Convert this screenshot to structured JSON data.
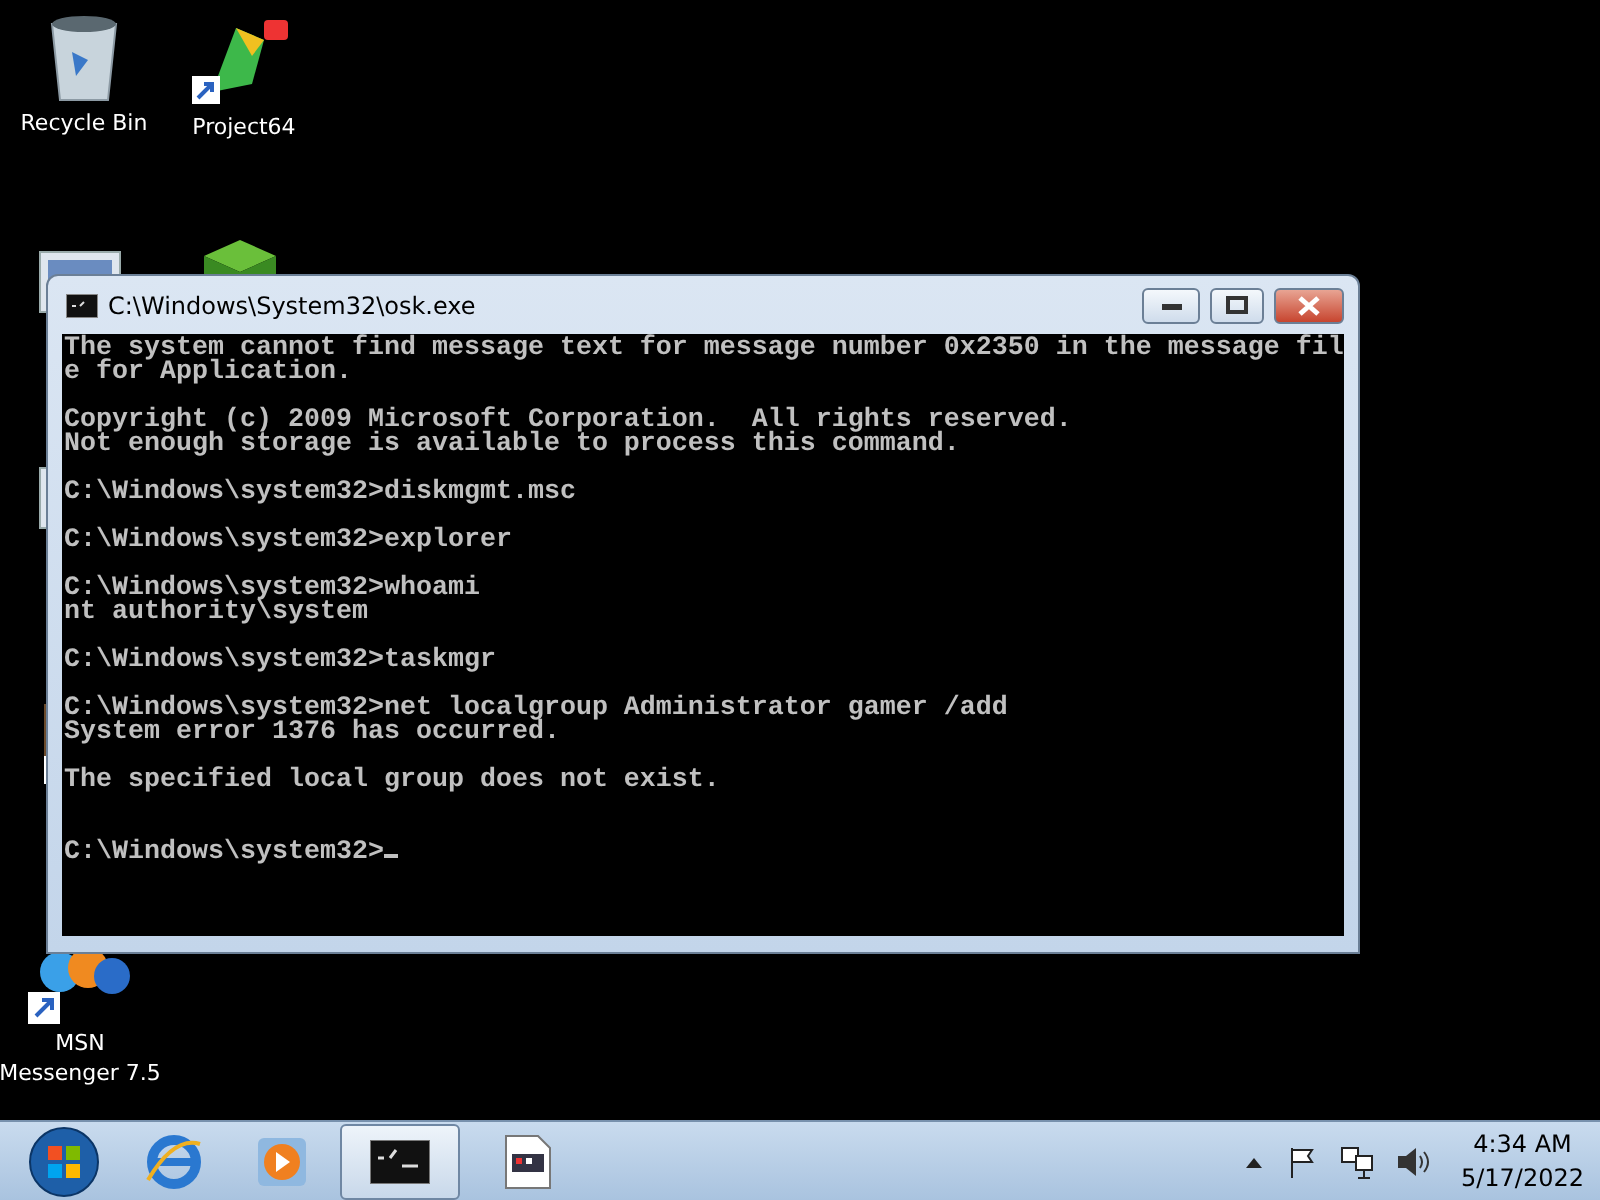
{
  "desktop": {
    "icons": [
      {
        "kind": "recycle-bin",
        "label_lines": [
          "Recycle Bin"
        ]
      },
      {
        "kind": "game-shortcut",
        "label_lines": [
          "Project64"
        ]
      },
      {
        "kind": "monitor"
      },
      {
        "kind": "cube"
      },
      {
        "kind": "monitor-small"
      },
      {
        "kind": "app-shortcut"
      },
      {
        "kind": "messenger",
        "label_lines": [
          "MSN",
          "Messenger 7.5"
        ]
      }
    ]
  },
  "window": {
    "title": "C:\\Windows\\System32\\osk.exe",
    "console": [
      {
        "kind": "text",
        "text": "The system cannot find message text for message number 0x2350 in the message fil"
      },
      {
        "kind": "text",
        "text": "e for Application."
      },
      {
        "kind": "blank"
      },
      {
        "kind": "text",
        "text": "Copyright (c) 2009 Microsoft Corporation.  All rights reserved."
      },
      {
        "kind": "text",
        "text": "Not enough storage is available to process this command."
      },
      {
        "kind": "blank"
      },
      {
        "kind": "text",
        "text": "C:\\Windows\\system32>diskmgmt.msc"
      },
      {
        "kind": "blank"
      },
      {
        "kind": "text",
        "text": "C:\\Windows\\system32>explorer"
      },
      {
        "kind": "blank"
      },
      {
        "kind": "text",
        "text": "C:\\Windows\\system32>whoami"
      },
      {
        "kind": "text",
        "text": "nt authority\\system"
      },
      {
        "kind": "blank"
      },
      {
        "kind": "text",
        "text": "C:\\Windows\\system32>taskmgr"
      },
      {
        "kind": "blank"
      },
      {
        "kind": "text",
        "text": "C:\\Windows\\system32>net localgroup Administrator gamer /add"
      },
      {
        "kind": "text",
        "text": "System error 1376 has occurred."
      },
      {
        "kind": "blank"
      },
      {
        "kind": "text",
        "text": "The specified local group does not exist."
      },
      {
        "kind": "blank"
      },
      {
        "kind": "blank"
      },
      {
        "kind": "prompt",
        "text": "C:\\Windows\\system32>",
        "cursor": true
      }
    ]
  },
  "taskbar": {
    "items": [
      {
        "kind": "browser",
        "selected": false
      },
      {
        "kind": "media",
        "selected": false
      },
      {
        "kind": "console",
        "selected": true
      },
      {
        "kind": "keyboard",
        "selected": false
      }
    ],
    "tray": {
      "time": "4:34 AM",
      "date": "5/17/2022"
    }
  }
}
